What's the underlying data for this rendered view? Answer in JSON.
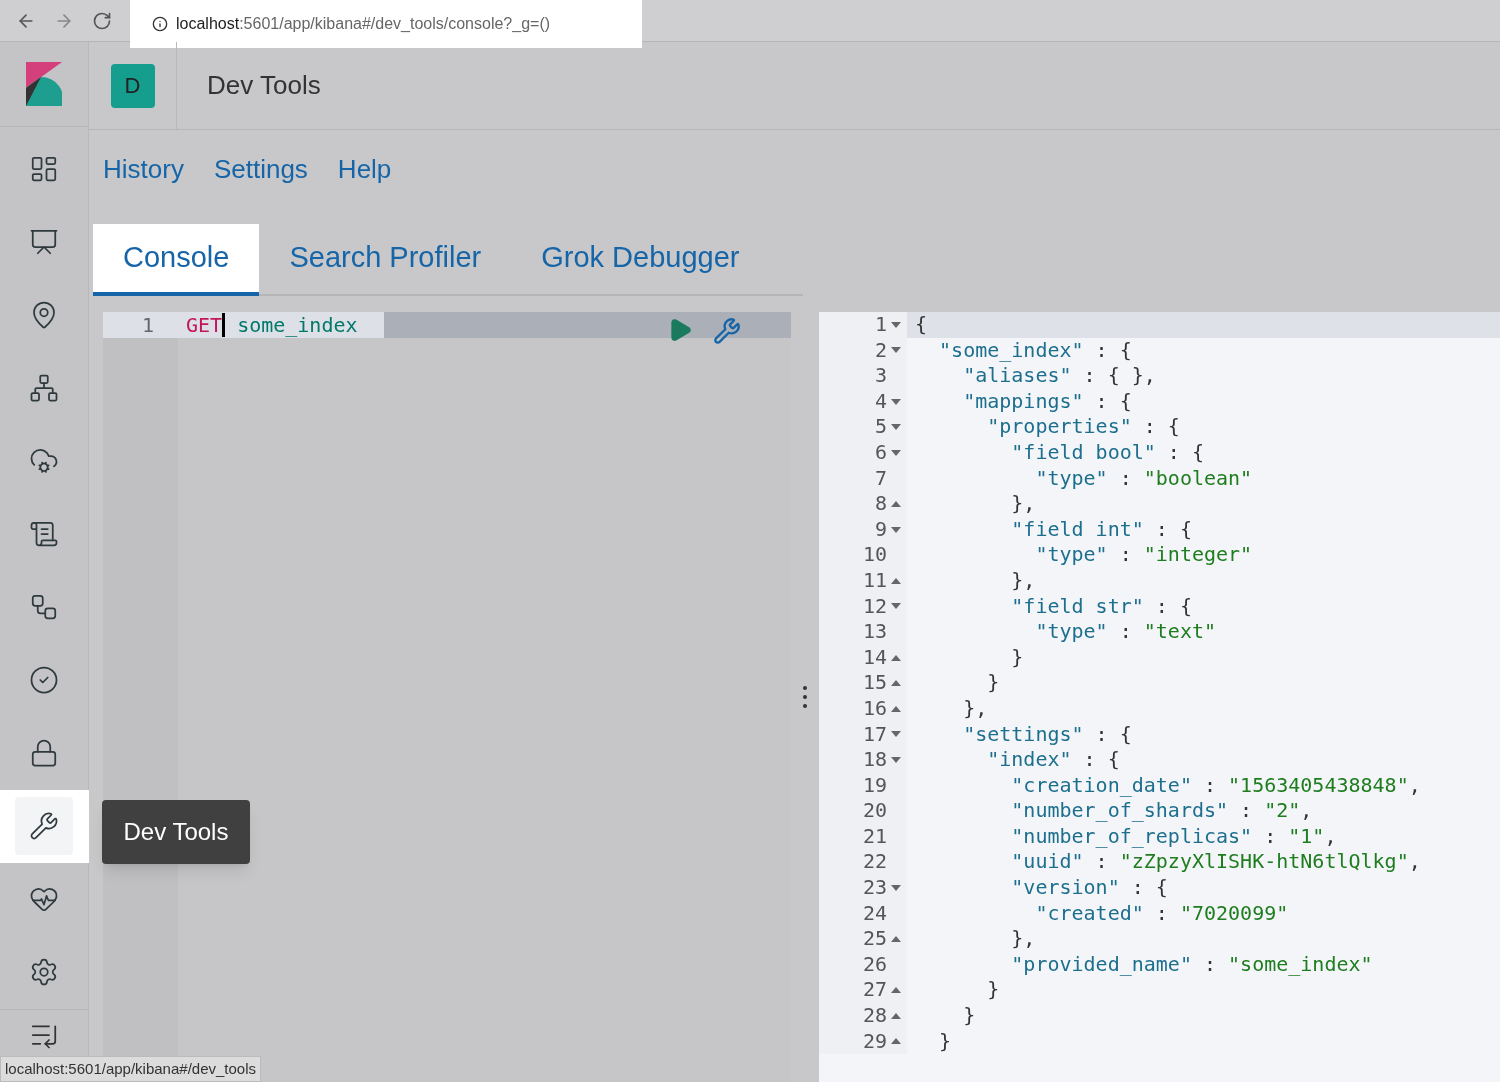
{
  "browser": {
    "url_host": "localhost",
    "url_path": ":5601/app/kibana#/dev_tools/console?_g=()"
  },
  "header": {
    "space_initial": "D",
    "title": "Dev Tools"
  },
  "top_links": [
    "History",
    "Settings",
    "Help"
  ],
  "tabs": [
    {
      "label": "Console",
      "selected": true
    },
    {
      "label": "Search Profiler",
      "selected": false
    },
    {
      "label": "Grok Debugger",
      "selected": false
    }
  ],
  "sidebar": {
    "items": [
      {
        "selected": false
      },
      {
        "selected": false
      },
      {
        "selected": false
      },
      {
        "selected": false
      },
      {
        "selected": false
      },
      {
        "selected": false
      },
      {
        "selected": false
      },
      {
        "selected": false
      },
      {
        "selected": false
      },
      {
        "selected": true
      },
      {
        "selected": false
      },
      {
        "selected": false
      }
    ],
    "tooltip": "Dev Tools"
  },
  "request": {
    "line_number": "1",
    "method": "GET",
    "path": "some_index"
  },
  "response": {
    "n": "1",
    "tokens": [
      {
        "kind": "punct",
        "text": "{"
      }
    ],
    "children": [
      {
        "n": "2",
        "tokens": [
          {
            "kind": "key",
            "text": "\"some_index\""
          },
          {
            "kind": "punct",
            "text": " : {"
          }
        ],
        "close": {
          "n": "29",
          "tokens": [
            {
              "kind": "punct",
              "text": "}"
            }
          ]
        },
        "children": [
          {
            "n": "3",
            "tokens": [
              {
                "kind": "key",
                "text": "\"aliases\""
              },
              {
                "kind": "punct",
                "text": " : { },"
              }
            ]
          },
          {
            "n": "4",
            "tokens": [
              {
                "kind": "key",
                "text": "\"mappings\""
              },
              {
                "kind": "punct",
                "text": " : {"
              }
            ],
            "close": {
              "n": "16",
              "tokens": [
                {
                  "kind": "punct",
                  "text": "},"
                }
              ]
            },
            "children": [
              {
                "n": "5",
                "tokens": [
                  {
                    "kind": "key",
                    "text": "\"properties\""
                  },
                  {
                    "kind": "punct",
                    "text": " : {"
                  }
                ],
                "close": {
                  "n": "15",
                  "tokens": [
                    {
                      "kind": "punct",
                      "text": "}"
                    }
                  ]
                },
                "children": [
                  {
                    "n": "6",
                    "tokens": [
                      {
                        "kind": "key",
                        "text": "\"field bool\""
                      },
                      {
                        "kind": "punct",
                        "text": " : {"
                      }
                    ],
                    "close": {
                      "n": "8",
                      "tokens": [
                        {
                          "kind": "punct",
                          "text": "},"
                        }
                      ]
                    },
                    "children": [
                      {
                        "n": "7",
                        "tokens": [
                          {
                            "kind": "key",
                            "text": "\"type\""
                          },
                          {
                            "kind": "punct",
                            "text": " : "
                          },
                          {
                            "kind": "string",
                            "text": "\"boolean\""
                          }
                        ]
                      }
                    ]
                  },
                  {
                    "n": "9",
                    "tokens": [
                      {
                        "kind": "key",
                        "text": "\"field int\""
                      },
                      {
                        "kind": "punct",
                        "text": " : {"
                      }
                    ],
                    "close": {
                      "n": "11",
                      "tokens": [
                        {
                          "kind": "punct",
                          "text": "},"
                        }
                      ]
                    },
                    "children": [
                      {
                        "n": "10",
                        "tokens": [
                          {
                            "kind": "key",
                            "text": "\"type\""
                          },
                          {
                            "kind": "punct",
                            "text": " : "
                          },
                          {
                            "kind": "string",
                            "text": "\"integer\""
                          }
                        ]
                      }
                    ]
                  },
                  {
                    "n": "12",
                    "tokens": [
                      {
                        "kind": "key",
                        "text": "\"field str\""
                      },
                      {
                        "kind": "punct",
                        "text": " : {"
                      }
                    ],
                    "close": {
                      "n": "14",
                      "tokens": [
                        {
                          "kind": "punct",
                          "text": "}"
                        }
                      ]
                    },
                    "children": [
                      {
                        "n": "13",
                        "tokens": [
                          {
                            "kind": "key",
                            "text": "\"type\""
                          },
                          {
                            "kind": "punct",
                            "text": " : "
                          },
                          {
                            "kind": "string",
                            "text": "\"text\""
                          }
                        ]
                      }
                    ]
                  }
                ]
              }
            ]
          },
          {
            "n": "17",
            "tokens": [
              {
                "kind": "key",
                "text": "\"settings\""
              },
              {
                "kind": "punct",
                "text": " : {"
              }
            ],
            "close": {
              "n": "28",
              "tokens": [
                {
                  "kind": "punct",
                  "text": "}"
                }
              ]
            },
            "children": [
              {
                "n": "18",
                "tokens": [
                  {
                    "kind": "key",
                    "text": "\"index\""
                  },
                  {
                    "kind": "punct",
                    "text": " : {"
                  }
                ],
                "close": {
                  "n": "27",
                  "tokens": [
                    {
                      "kind": "punct",
                      "text": "}"
                    }
                  ]
                },
                "children": [
                  {
                    "n": "19",
                    "tokens": [
                      {
                        "kind": "key",
                        "text": "\"creation_date\""
                      },
                      {
                        "kind": "punct",
                        "text": " : "
                      },
                      {
                        "kind": "string",
                        "text": "\"1563405438848\""
                      },
                      {
                        "kind": "punct",
                        "text": ","
                      }
                    ]
                  },
                  {
                    "n": "20",
                    "tokens": [
                      {
                        "kind": "key",
                        "text": "\"number_of_shards\""
                      },
                      {
                        "kind": "punct",
                        "text": " : "
                      },
                      {
                        "kind": "string",
                        "text": "\"2\""
                      },
                      {
                        "kind": "punct",
                        "text": ","
                      }
                    ]
                  },
                  {
                    "n": "21",
                    "tokens": [
                      {
                        "kind": "key",
                        "text": "\"number_of_replicas\""
                      },
                      {
                        "kind": "punct",
                        "text": " : "
                      },
                      {
                        "kind": "string",
                        "text": "\"1\""
                      },
                      {
                        "kind": "punct",
                        "text": ","
                      }
                    ]
                  },
                  {
                    "n": "22",
                    "tokens": [
                      {
                        "kind": "key",
                        "text": "\"uuid\""
                      },
                      {
                        "kind": "punct",
                        "text": " : "
                      },
                      {
                        "kind": "string",
                        "text": "\"zZpzyXlISHK-htN6tlQlkg\""
                      },
                      {
                        "kind": "punct",
                        "text": ","
                      }
                    ]
                  },
                  {
                    "n": "23",
                    "tokens": [
                      {
                        "kind": "key",
                        "text": "\"version\""
                      },
                      {
                        "kind": "punct",
                        "text": " : {"
                      }
                    ],
                    "close": {
                      "n": "25",
                      "tokens": [
                        {
                          "kind": "punct",
                          "text": "},"
                        }
                      ]
                    },
                    "children": [
                      {
                        "n": "24",
                        "tokens": [
                          {
                            "kind": "key",
                            "text": "\"created\""
                          },
                          {
                            "kind": "punct",
                            "text": " : "
                          },
                          {
                            "kind": "string",
                            "text": "\"7020099\""
                          }
                        ]
                      }
                    ]
                  },
                  {
                    "n": "26",
                    "tokens": [
                      {
                        "kind": "key",
                        "text": "\"provided_name\""
                      },
                      {
                        "kind": "punct",
                        "text": " : "
                      },
                      {
                        "kind": "string",
                        "text": "\"some_index\""
                      }
                    ]
                  }
                ]
              }
            ]
          }
        ]
      }
    ]
  },
  "status_bar": "localhost:5601/app/kibana#/dev_tools"
}
